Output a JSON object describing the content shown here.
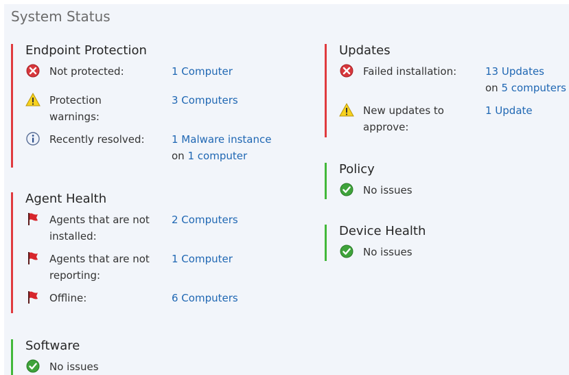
{
  "title": "System Status",
  "sections": {
    "endpoint": {
      "title": "Endpoint Protection",
      "rows": [
        {
          "icon": "error-icon",
          "label": "Not protected:",
          "value": "1 Computer"
        },
        {
          "icon": "warning-icon",
          "label": "Protection warnings:",
          "label_line1": "Protection",
          "label_line2": "warnings:",
          "value": "3 Computers"
        },
        {
          "icon": "info-icon",
          "label": "Recently resolved:",
          "value": "1 Malware instance",
          "sub_prefix": "on",
          "sub_link": "1 computer"
        }
      ]
    },
    "agent": {
      "title": "Agent Health",
      "rows": [
        {
          "icon": "flag-icon",
          "label_line1": "Agents that are not",
          "label_line2": "installed:",
          "value": "2 Computers"
        },
        {
          "icon": "flag-icon",
          "label_line1": "Agents that are not",
          "label_line2": "reporting:",
          "value": "1 Computer"
        },
        {
          "icon": "flag-icon",
          "label": "Offline:",
          "value": "6 Computers"
        }
      ]
    },
    "software": {
      "title": "Software",
      "status": "No issues"
    },
    "updates": {
      "title": "Updates",
      "rows": [
        {
          "icon": "error-icon",
          "label": "Failed installation:",
          "value": "13 Updates",
          "sub_prefix": "on",
          "sub_link": "5 computers"
        },
        {
          "icon": "warning-icon",
          "label_line1": "New updates to",
          "label_line2": "approve:",
          "value": "1 Update"
        }
      ]
    },
    "policy": {
      "title": "Policy",
      "status": "No issues"
    },
    "device": {
      "title": "Device Health",
      "status": "No issues"
    }
  },
  "colors": {
    "error_bar": "#e03a3e",
    "ok_bar": "#42b83a",
    "link": "#1f67b3"
  }
}
